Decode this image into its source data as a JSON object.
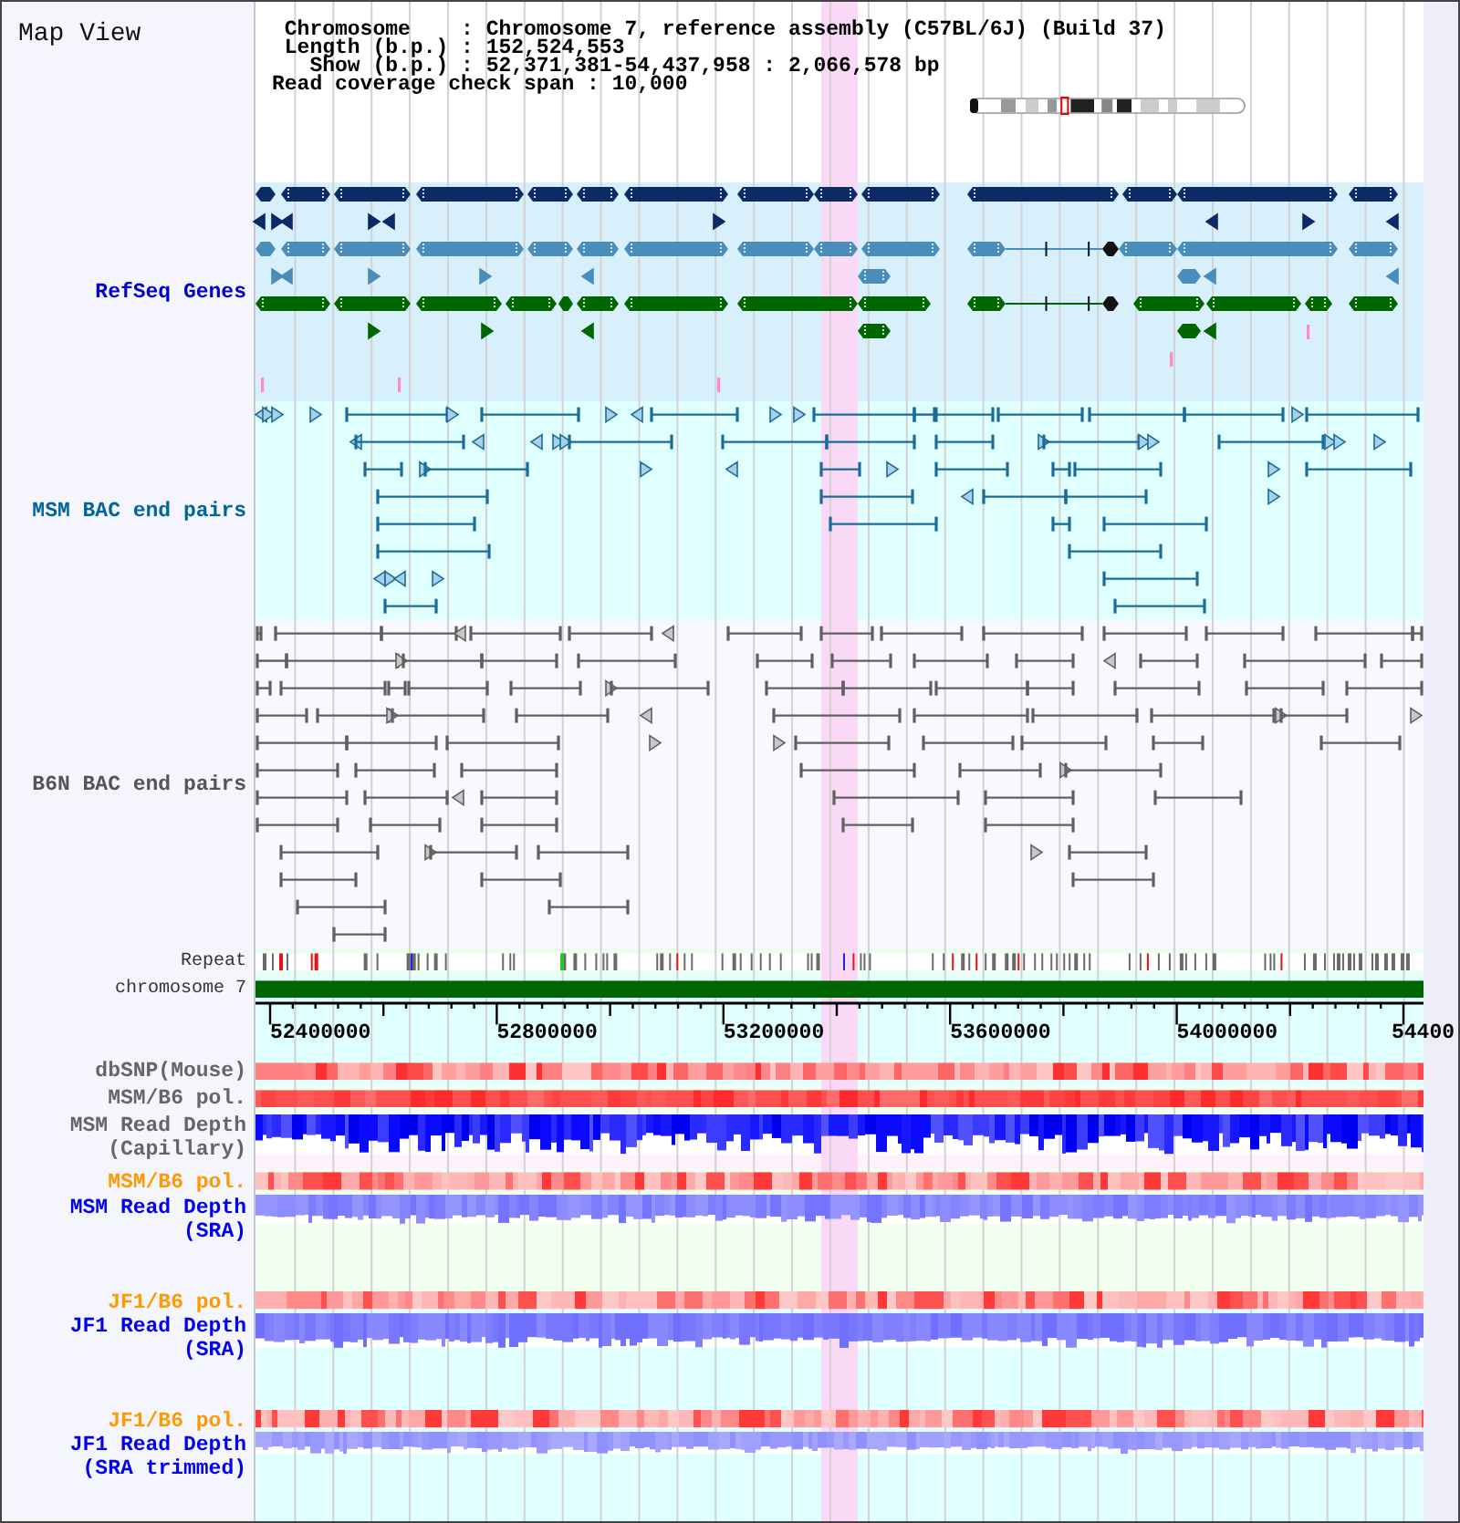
{
  "title": "Map View",
  "header": {
    "lines": [
      " Chromosome    : Chromosome 7, reference assembly (C57BL/6J) (Build 37)",
      " Length (b.p.) : 152,524,553",
      "   Show (b.p.) : 52,371,381-54,437,958 : 2,066,578 bp",
      "Read coverage check span : 10,000"
    ]
  },
  "tracks": [
    {
      "kind": "genes",
      "label": "RefSeq Genes",
      "color": "#0000cc"
    },
    {
      "kind": "bac_pairs",
      "label": "MSM BAC end pairs",
      "color": "#006699"
    },
    {
      "kind": "bac_pairs",
      "label": "B6N BAC end pairs",
      "color": "#555555"
    },
    {
      "kind": "repeat",
      "label": "Repeat",
      "color": "#333333"
    },
    {
      "kind": "chromosome",
      "label": "chromosome 7",
      "color": "#333333"
    },
    {
      "kind": "axis",
      "ticks": [
        "52400000",
        "52800000",
        "53200000",
        "53600000",
        "54000000",
        "54400"
      ]
    },
    {
      "kind": "heatmap",
      "label": "dbSNP(Mouse)",
      "color": "#666666"
    },
    {
      "kind": "heatmap",
      "label": "MSM/B6 pol.",
      "color": "#666666"
    },
    {
      "kind": "depth",
      "label": "MSM Read Depth (Capillary)",
      "color": "#666666"
    },
    {
      "kind": "heatmap",
      "label": "MSM/B6 pol.",
      "color": "#ff9900"
    },
    {
      "kind": "depth",
      "label": "MSM Read Depth (SRA)",
      "color": "#0000ee"
    },
    {
      "kind": "heatmap",
      "label": "JF1/B6 pol.",
      "color": "#ff9900"
    },
    {
      "kind": "depth",
      "label": "JF1 Read Depth (SRA)",
      "color": "#0000ee"
    },
    {
      "kind": "heatmap",
      "label": "JF1/B6 pol.",
      "color": "#ff9900"
    },
    {
      "kind": "depth",
      "label": "JF1 Read Depth (SRA trimmed)",
      "color": "#0000ee"
    }
  ]
}
